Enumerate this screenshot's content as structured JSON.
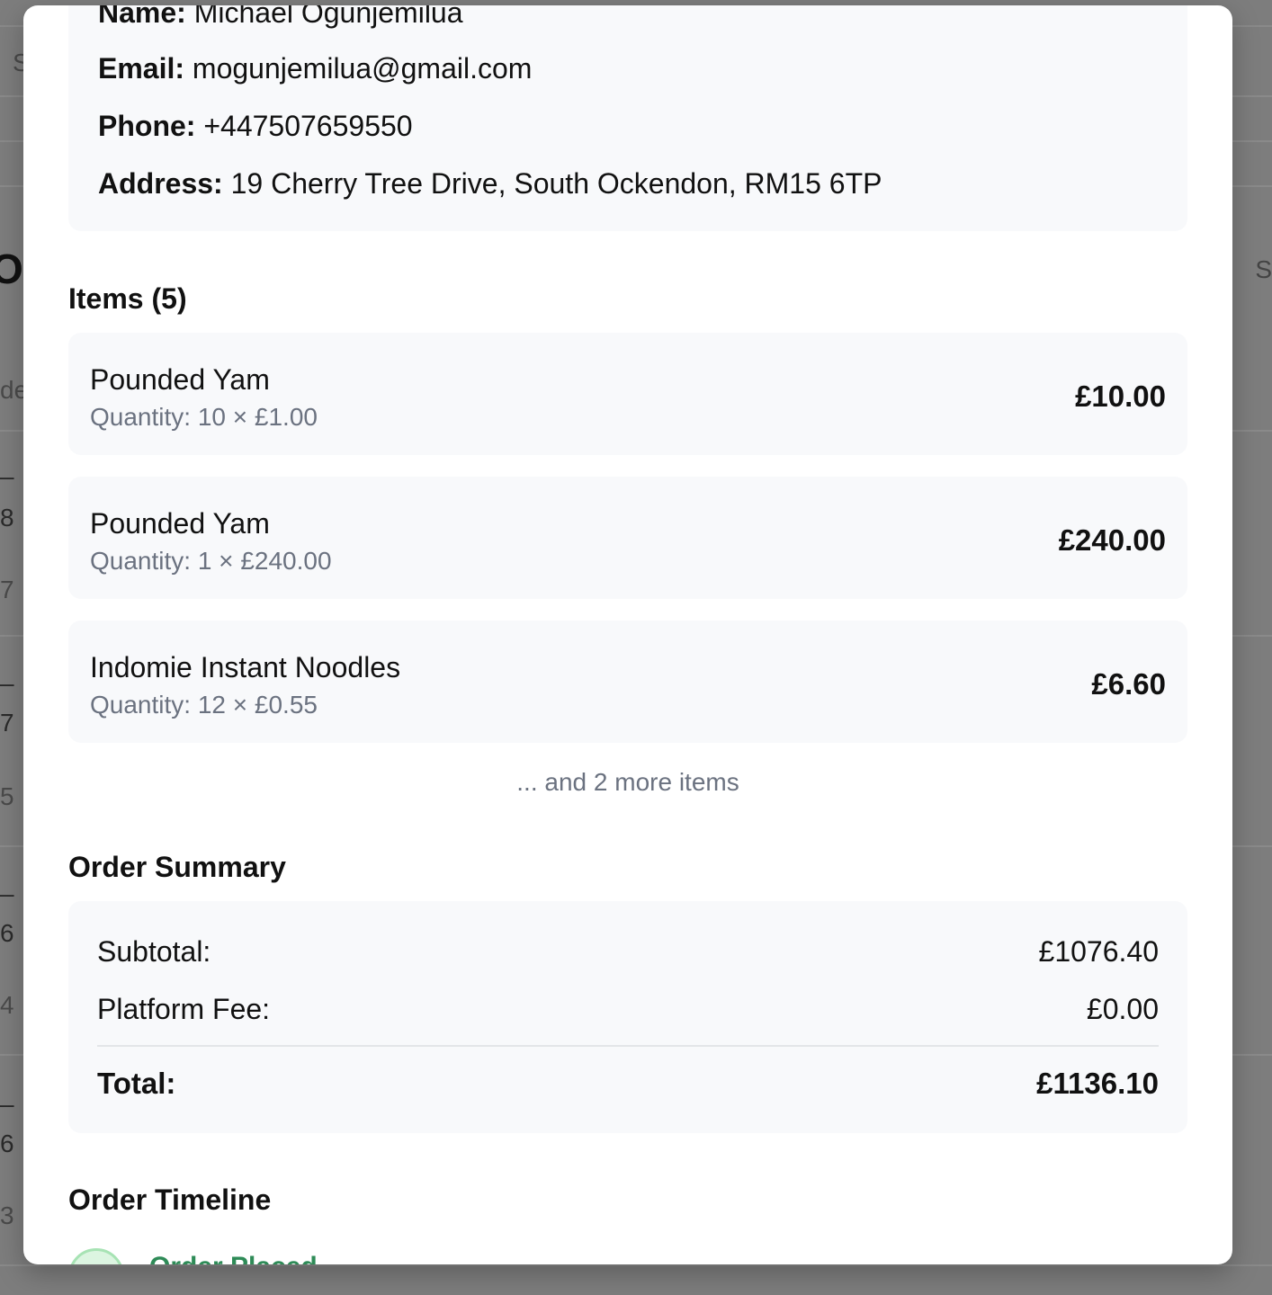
{
  "customer": {
    "name_label": "Name:",
    "name_value": "Michael Ogunjemilua",
    "email_label": "Email:",
    "email_value": "mogunjemilua@gmail.com",
    "phone_label": "Phone:",
    "phone_value": "+447507659550",
    "address_label": "Address:",
    "address_value": "19 Cherry Tree Drive, South Ockendon, RM15 6TP"
  },
  "items": {
    "title": "Items (5)",
    "list": [
      {
        "name": "Pounded Yam",
        "quantity": "Quantity: 10 × £1.00",
        "total": "£10.00"
      },
      {
        "name": "Pounded Yam",
        "quantity": "Quantity: 1 × £240.00",
        "total": "£240.00"
      },
      {
        "name": "Indomie Instant Noodles",
        "quantity": "Quantity: 12 × £0.55",
        "total": "£6.60"
      }
    ],
    "more": "... and 2 more items"
  },
  "summary": {
    "title": "Order Summary",
    "subtotal_label": "Subtotal:",
    "subtotal_value": "£1076.40",
    "fee_label": "Platform Fee:",
    "fee_value": "£0.00",
    "total_label": "Total:",
    "total_value": "£1136.10"
  },
  "timeline": {
    "title": "Order Timeline",
    "first_step": "Order Placed"
  },
  "background": {
    "frag_s": "S",
    "frag_o": "O",
    "frag_de": "de",
    "frag_dash": "–",
    "frag_8": "8",
    "frag_7": "7",
    "frag_5": "5",
    "frag_6": "6",
    "frag_4": "4",
    "frag_3": "3",
    "frag_right_s": "S"
  }
}
